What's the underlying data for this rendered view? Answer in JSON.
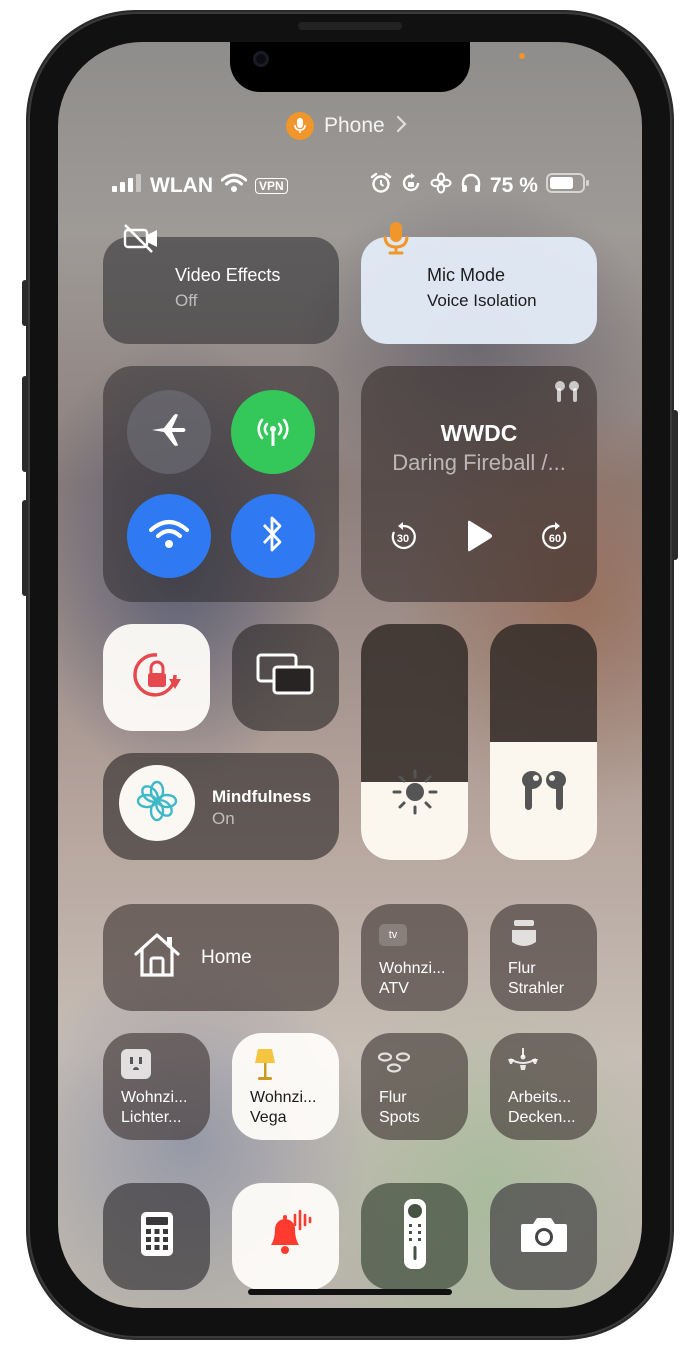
{
  "header": {
    "app_label": "Phone"
  },
  "status_bar": {
    "carrier": "WLAN",
    "vpn": "VPN",
    "battery_text": "75 %",
    "battery_level": 0.75
  },
  "modules": {
    "video_effects": {
      "title": "Video Effects",
      "state": "Off"
    },
    "mic_mode": {
      "title": "Mic Mode",
      "state": "Voice Isolation"
    },
    "now_playing": {
      "title": "WWDC",
      "subtitle": "Daring Fireball /...",
      "skip_back": "30",
      "skip_forward": "60"
    },
    "mindfulness": {
      "title": "Mindfulness",
      "state": "On"
    },
    "brightness_level": 0.33,
    "volume_level": 0.5,
    "home": {
      "label": "Home"
    },
    "atv": {
      "line1": "Wohnzi...",
      "line2": "ATV",
      "badge": "tv"
    },
    "flur_strahler": {
      "line1": "Flur",
      "line2": "Strahler"
    },
    "wohnzi_lichter": {
      "line1": "Wohnzi...",
      "line2": "Lichter..."
    },
    "wohnzi_vega": {
      "line1": "Wohnzi...",
      "line2": "Vega"
    },
    "flur_spots": {
      "line1": "Flur",
      "line2": "Spots"
    },
    "arbeits": {
      "line1": "Arbeits...",
      "line2": "Decken..."
    }
  },
  "colors": {
    "accent_orange": "#f0962a",
    "cellular_green": "#34c759",
    "active_blue": "#2f7af2",
    "rotation_red": "#e5484d",
    "alert_red": "#ff3b30",
    "mindfulness_teal": "#3fb8c8"
  },
  "icons": [
    "mic-icon",
    "chevron-right-icon",
    "signal-bars-icon",
    "wifi-icon",
    "alarm-icon",
    "rotation-lock-icon",
    "flower-icon",
    "headphones-icon",
    "battery-icon",
    "video-off-icon",
    "airplane-icon",
    "antenna-icon",
    "bluetooth-icon",
    "airpods-icon",
    "skip-back-icon",
    "play-icon",
    "skip-forward-icon",
    "screen-mirror-icon",
    "sun-icon",
    "house-icon",
    "appletv-icon",
    "ceiling-light-icon",
    "outlet-icon",
    "lamp-icon",
    "spots-icon",
    "chandelier-icon",
    "calculator-icon",
    "bell-sound-icon",
    "remote-icon",
    "camera-icon"
  ]
}
